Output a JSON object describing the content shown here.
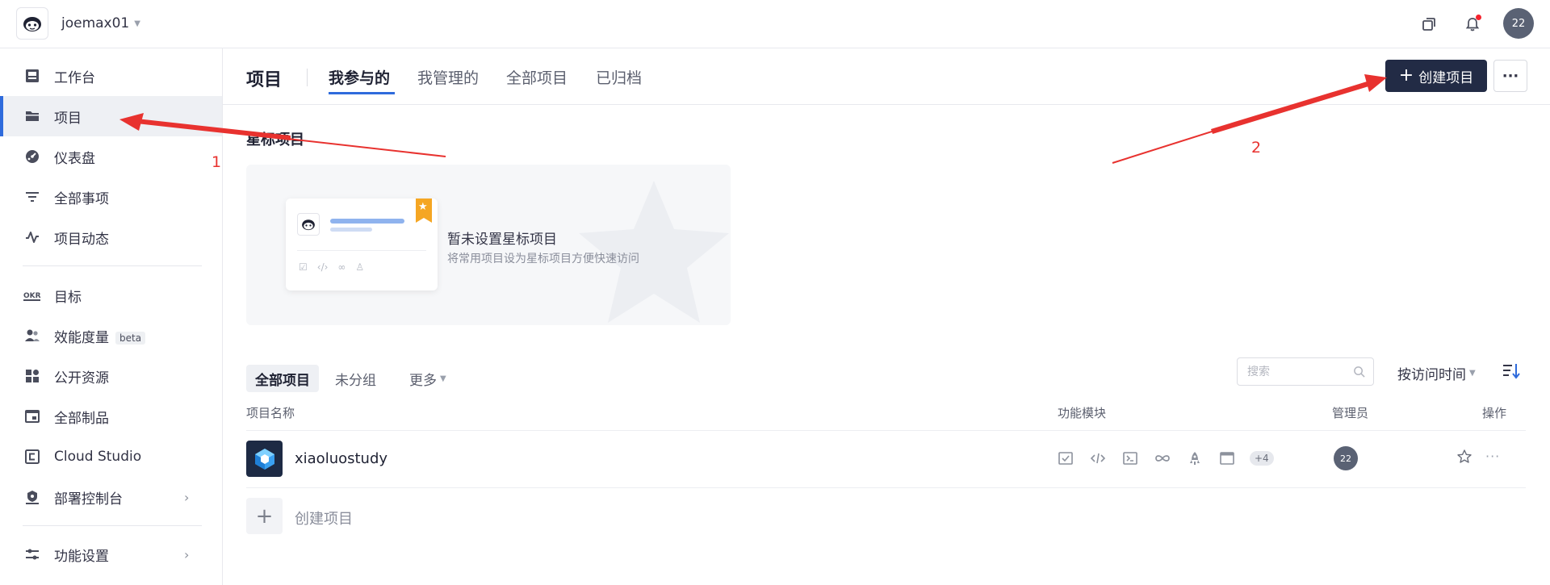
{
  "topbar": {
    "team_name": "joemax01",
    "avatar_text": "22",
    "icons": [
      "app-logo-icon",
      "window-switch-icon",
      "bell-icon"
    ]
  },
  "sidebar": {
    "items": [
      {
        "label": "工作台",
        "icon": "workbench-icon"
      },
      {
        "label": "项目",
        "icon": "folder-icon",
        "active": true
      },
      {
        "label": "仪表盘",
        "icon": "dashboard-icon"
      },
      {
        "label": "全部事项",
        "icon": "filter-list-icon"
      },
      {
        "label": "项目动态",
        "icon": "activity-icon"
      },
      {
        "label": "目标",
        "icon": "okr-icon"
      },
      {
        "label": "效能度量",
        "icon": "people-metrics-icon",
        "badge": "beta"
      },
      {
        "label": "公开资源",
        "icon": "grid-resource-icon"
      },
      {
        "label": "全部制品",
        "icon": "artifact-icon"
      },
      {
        "label": "Cloud Studio",
        "icon": "cloud-studio-icon"
      },
      {
        "label": "部署控制台",
        "icon": "deploy-icon"
      },
      {
        "label": "功能设置",
        "icon": "settings-sliders-icon"
      }
    ]
  },
  "header": {
    "title": "项目",
    "tabs": [
      {
        "label": "我参与的",
        "active": true
      },
      {
        "label": "我管理的"
      },
      {
        "label": "全部项目"
      },
      {
        "label": "已归档"
      }
    ],
    "create_label": "创建项目",
    "more_label": "···"
  },
  "starred": {
    "title": "星标项目",
    "empty_title": "暂未设置星标项目",
    "empty_sub": "将常用项目设为星标项目方便快速访问"
  },
  "filters": {
    "items": [
      "全部项目",
      "未分组",
      "更多"
    ],
    "search_placeholder": "搜索",
    "sort_label": "按访问时间"
  },
  "table": {
    "columns": [
      "项目名称",
      "功能模块",
      "管理员",
      "操作"
    ],
    "rows": [
      {
        "name": "xiaoluostudy",
        "modules": [
          "issue-check-icon",
          "code-icon",
          "terminal-icon",
          "infinity-icon",
          "rocket-icon",
          "artifact-box-icon"
        ],
        "modules_more": "+4",
        "admin": "22"
      }
    ],
    "create_label": "创建项目",
    "create_plus": "+"
  },
  "annotations": {
    "label_1": "1",
    "label_2": "2",
    "color": "#e8322f"
  },
  "colors": {
    "accent": "#2f6bdc",
    "create_button": "#222b45"
  }
}
